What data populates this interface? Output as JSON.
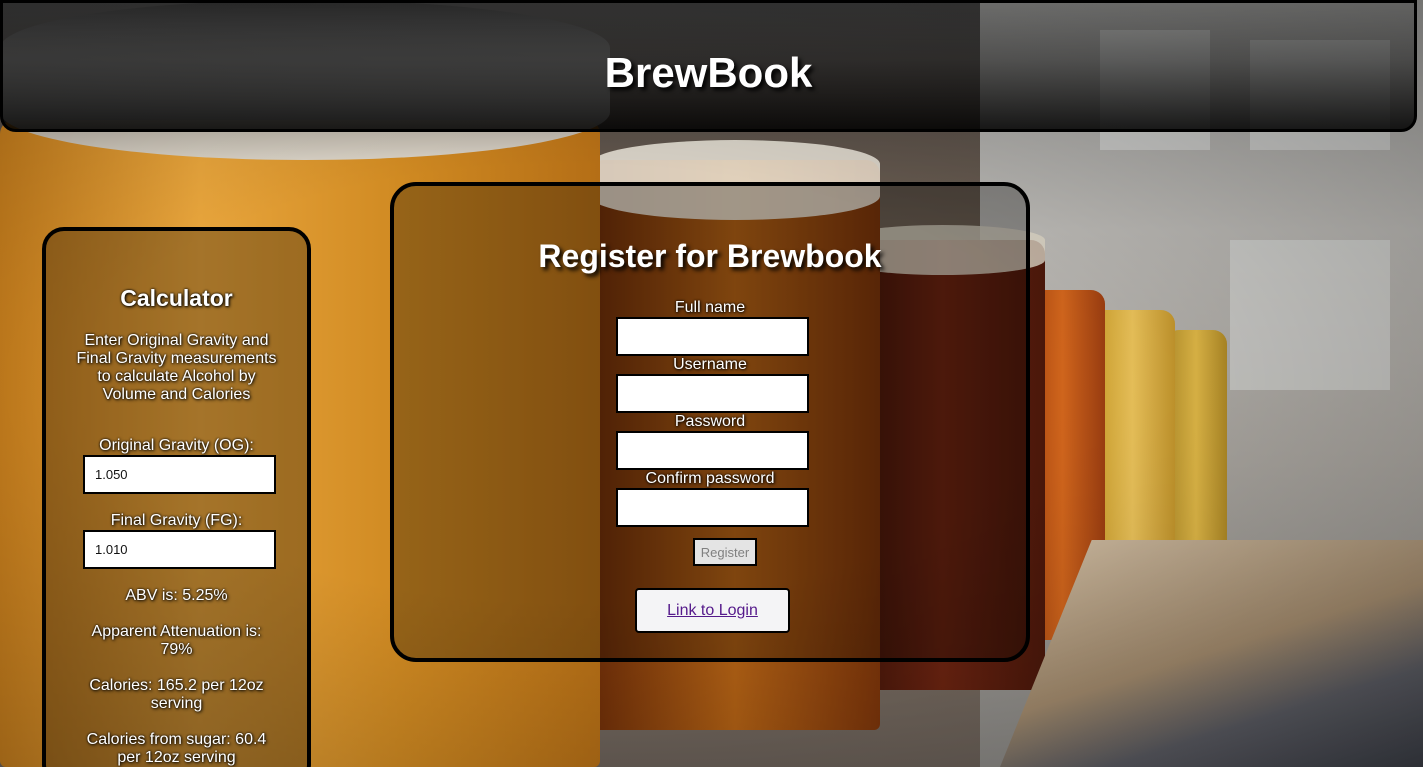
{
  "header": {
    "title": "BrewBook"
  },
  "calculator": {
    "title": "Calculator",
    "description": "Enter Original Gravity and Final Gravity measurements to calculate Alcohol by Volume and Calories",
    "og_label": "Original Gravity (OG):",
    "og_value": "1.050",
    "fg_label": "Final Gravity (FG):",
    "fg_value": "1.010",
    "abv": "ABV is: 5.25%",
    "attenuation": "Apparent Attenuation is: 79%",
    "calories": "Calories: 165.2 per 12oz serving",
    "calories_sugar": "Calories from sugar: 60.4 per 12oz serving"
  },
  "register": {
    "title": "Register for Brewbook",
    "fields": {
      "full_name": {
        "label": "Full name",
        "value": ""
      },
      "username": {
        "label": "Username",
        "value": ""
      },
      "password": {
        "label": "Password",
        "value": ""
      },
      "confirm_password": {
        "label": "Confirm password",
        "value": ""
      }
    },
    "submit_label": "Register",
    "login_link": "Link to Login"
  }
}
